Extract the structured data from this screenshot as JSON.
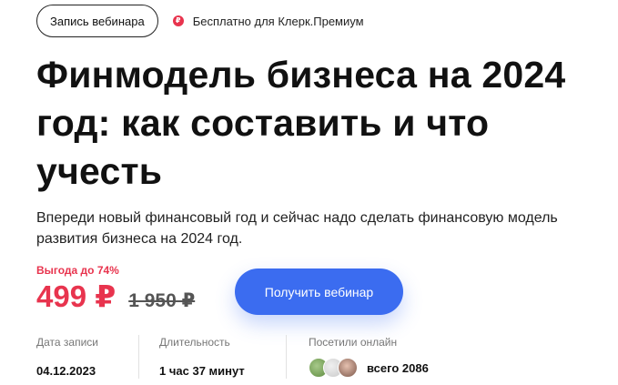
{
  "header": {
    "webinar_button": "Запись вебинара",
    "premium_icon": "ruble-badge-icon",
    "premium_text": "Бесплатно для Клерк.Премиум"
  },
  "main": {
    "title": "Финмодель бизнеса на 2024 год: как составить и что учесть",
    "description": "Впереди новый финансовый год и сейчас надо сделать финансовую модель развития бизнеса на 2024 год."
  },
  "pricing": {
    "discount": "Выгода до 74%",
    "price": "499 ₽",
    "old_price": "1 950 ₽",
    "cta": "Получить вебинар"
  },
  "meta": {
    "date_label": "Дата записи",
    "date_value": "04.12.2023",
    "duration_label": "Длительность",
    "duration_value": "1 час 37 минут",
    "online_label": "Посетили онлайн",
    "online_value": "всего 2086"
  },
  "colors": {
    "accent_red": "#e8344e",
    "accent_blue": "#3b6cf0"
  }
}
